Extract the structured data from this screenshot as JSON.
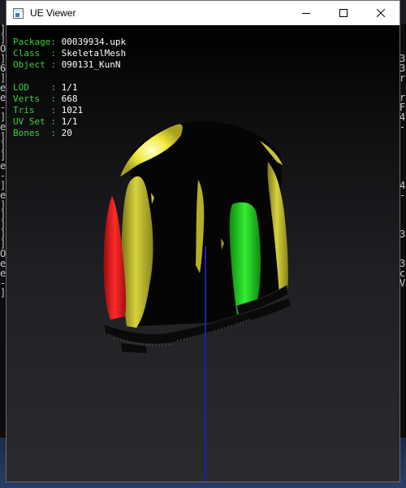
{
  "window": {
    "title": "UE Viewer",
    "controls": [
      "minimize",
      "maximize",
      "close"
    ]
  },
  "info": {
    "package": {
      "label": "Package: ",
      "value": "00039934.upk"
    },
    "class": {
      "label": "Class  : ",
      "value": "SkeletalMesh"
    },
    "object": {
      "label": "Object : ",
      "value": "090131_KunN"
    },
    "lod": {
      "label": "LOD    : ",
      "value": "1/1"
    },
    "verts": {
      "label": "Verts  : ",
      "value": "668"
    },
    "tris": {
      "label": "Tris   : ",
      "value": "1021"
    },
    "uvset": {
      "label": "UV Set : ",
      "value": "1/1"
    },
    "bones": {
      "label": "Bones  : ",
      "value": "20"
    }
  },
  "background_console": {
    "left": [
      "]",
      "]",
      "O",
      "]",
      "6",
      "]",
      "e",
      "e",
      "-",
      "]",
      "e",
      "]",
      "]",
      "]",
      "e",
      "-",
      "]",
      "e",
      "]",
      "]",
      "]",
      "]",
      "]",
      "O",
      "e",
      "e",
      "-",
      "]"
    ],
    "right": [
      "",
      "",
      "",
      "3",
      "3",
      "r",
      "",
      "r",
      "F",
      "4",
      "-",
      "",
      "",
      "",
      "",
      "",
      "4",
      "-",
      "",
      "",
      "",
      "3",
      "",
      "",
      "3",
      "c",
      "V",
      ""
    ]
  },
  "colors": {
    "info_label": "#38d23a",
    "info_value": "#ffffff",
    "mesh_body": "#c8c436",
    "mesh_left_arm": "#e61e1e",
    "mesh_right_arm": "#22cc22",
    "axis_line": "#1a22a8"
  }
}
